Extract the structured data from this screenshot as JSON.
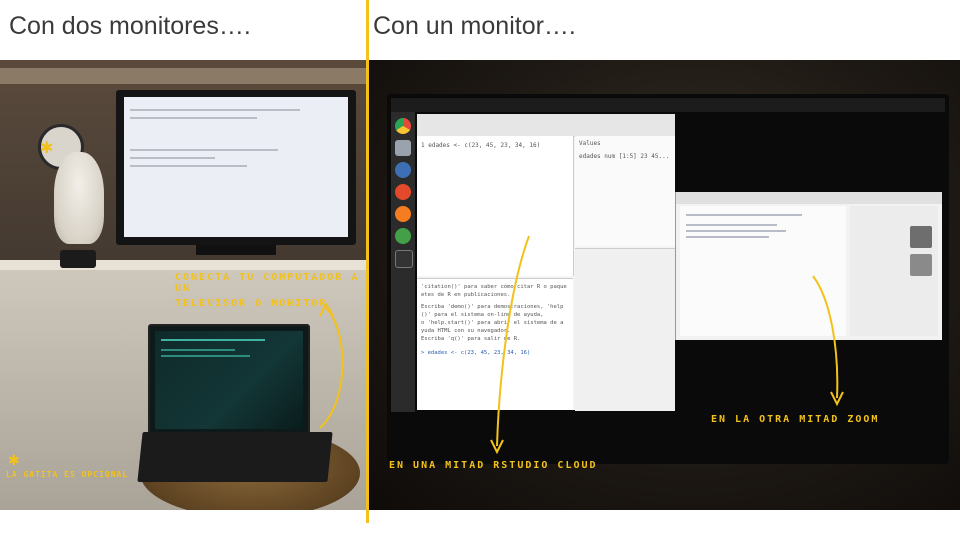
{
  "slide": {
    "left_heading": "Con dos monitores….",
    "right_heading": "Con un monitor….",
    "accent_color": "#f2c21b",
    "heading_color": "#3a3a3a"
  },
  "left_photo": {
    "annotations": {
      "connect": "Conecta tu computador a un",
      "tv": "televisor o monitor",
      "cat": "La gatita es opcional"
    }
  },
  "right_photo": {
    "annotations": {
      "rstudio": "En una mitad RStudio Cloud",
      "zoom": "En la otra mitad Zoom"
    },
    "rstudio": {
      "editor_line": "1  edades <- c(23, 45, 23, 34, 16)",
      "env_header": "Values",
      "env_value": "edades  num [1:5] 23 45...",
      "console_lines": [
        "'citation()' para saber cómo citar R o paque",
        "etes de R en publicaciones.",
        "Escriba 'demo()' para demostraciones, 'help",
        "()' para el sistema on-line de ayuda,",
        "o 'help.start()' para abrir el sistema de a",
        "yuda HTML con su navegador.",
        "Escriba 'q()' para salir de R.",
        "> edades <- c(23, 45, 23, 34, 16)"
      ]
    }
  }
}
